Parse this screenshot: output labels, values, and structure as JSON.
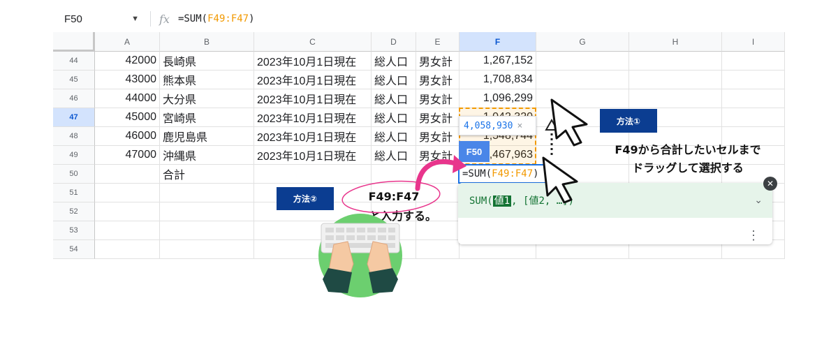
{
  "formula_bar": {
    "name_box": "F50",
    "fx": "fx",
    "formula_prefix": "=SUM(",
    "formula_range": "F49:F47",
    "formula_suffix": ")"
  },
  "columns": [
    "A",
    "B",
    "C",
    "D",
    "E",
    "F",
    "G",
    "H",
    "I"
  ],
  "rows": [
    {
      "num": "44",
      "a": "42000",
      "b": "長崎県",
      "c": "2023年10月1日現在",
      "d": "総人口",
      "e": "男女計",
      "f": "1,267,152"
    },
    {
      "num": "45",
      "a": "43000",
      "b": "熊本県",
      "c": "2023年10月1日現在",
      "d": "総人口",
      "e": "男女計",
      "f": "1,708,834"
    },
    {
      "num": "46",
      "a": "44000",
      "b": "大分県",
      "c": "2023年10月1日現在",
      "d": "総人口",
      "e": "男女計",
      "f": "1,096,299"
    },
    {
      "num": "47",
      "a": "45000",
      "b": "宮崎県",
      "c": "2023年10月1日現在",
      "d": "総人口",
      "e": "男女計",
      "f": "1,042,320"
    },
    {
      "num": "48",
      "a": "46000",
      "b": "鹿児島県",
      "c": "2023年10月1日現在",
      "d": "総人口",
      "e": "男女計",
      "f": "1,548,744"
    },
    {
      "num": "49",
      "a": "47000",
      "b": "沖縄県",
      "c": "2023年10月1日現在",
      "d": "総人口",
      "e": "男女計",
      "f": "1,467,963"
    },
    {
      "num": "50",
      "a": "",
      "b": "合計",
      "c": "",
      "d": "",
      "e": "",
      "f": ""
    },
    {
      "num": "51",
      "a": "",
      "b": "",
      "c": "",
      "d": "",
      "e": "",
      "f": ""
    },
    {
      "num": "52",
      "a": "",
      "b": "",
      "c": "",
      "d": "",
      "e": "",
      "f": ""
    },
    {
      "num": "53",
      "a": "",
      "b": "",
      "c": "",
      "d": "",
      "e": "",
      "f": ""
    },
    {
      "num": "54",
      "a": "",
      "b": "",
      "c": "",
      "d": "",
      "e": "",
      "f": ""
    }
  ],
  "tooltip": {
    "value": "4,058,930",
    "close": "×"
  },
  "ref_tag": "F50",
  "edit_cell": {
    "prefix": "=SUM(",
    "range": "F49:F47",
    "suffix": ")"
  },
  "help_panel": {
    "sum_open": "SUM(",
    "highlight": "値1",
    "rest": ", [値2, …])",
    "close": "✕"
  },
  "annotations": {
    "method1_badge": "方法①",
    "method1_line1": "F49から合計したいセルまで",
    "method1_line2": "ドラッグして選択する",
    "method2_badge": "方法②",
    "method2_line1": "F49:F47",
    "method2_line2": "と入力する。"
  },
  "colors": {
    "orange": "#f29900",
    "blue": "#1a73e8",
    "badge": "#0b3d91",
    "pink": "#e8358c",
    "green": "#6ccf6f"
  }
}
